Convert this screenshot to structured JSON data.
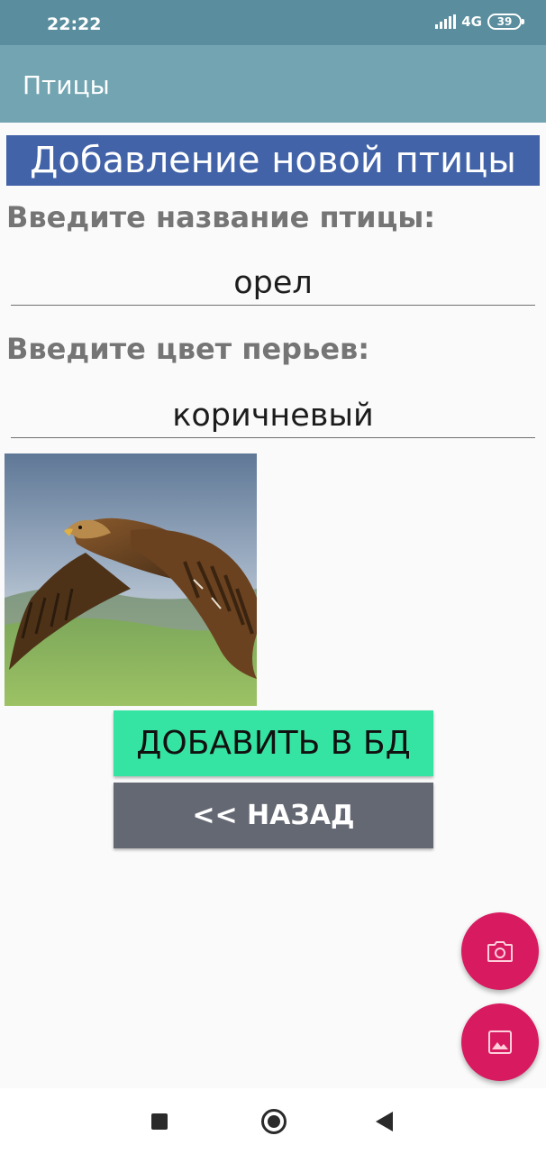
{
  "status_bar": {
    "time": "22:22",
    "network": "4G",
    "battery": "39"
  },
  "app_bar": {
    "title": "Птицы"
  },
  "form": {
    "header": "Добавление новой птицы",
    "name_label": "Введите название птицы:",
    "name_value": "орел",
    "color_label": "Введите цвет перьев:",
    "color_value": "коричневый"
  },
  "buttons": {
    "add_label": "ДОБАВИТЬ В БД",
    "back_label": "<< НАЗАД"
  },
  "fabs": {
    "camera_icon": "camera-icon",
    "gallery_icon": "image-icon"
  },
  "colors": {
    "status_bar": "#5a8e9e",
    "app_bar": "#72a4b2",
    "header": "#4263a8",
    "add_button": "#35e4a2",
    "back_button": "#646873",
    "fab": "#d81b60"
  }
}
